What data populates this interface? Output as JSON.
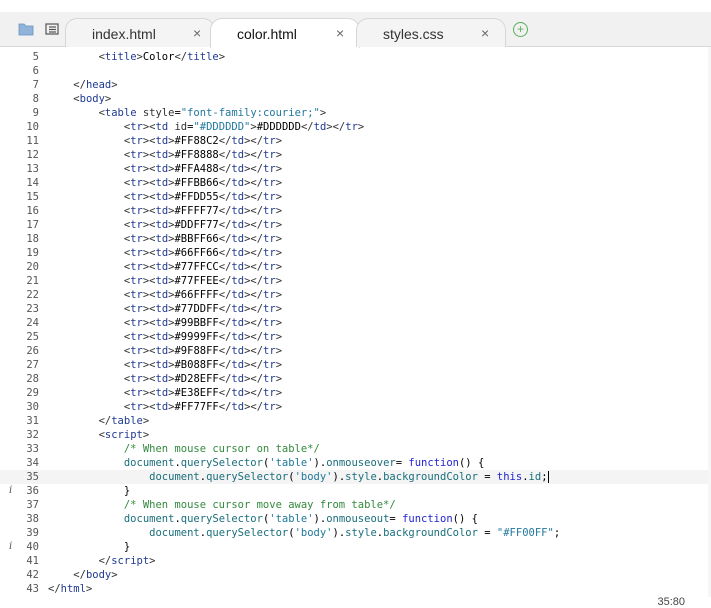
{
  "toolbar": {
    "icons": [
      "folder-icon",
      "outline-icon"
    ]
  },
  "tabs": [
    {
      "label": "index.html",
      "close": "×",
      "active": false
    },
    {
      "label": "color.html",
      "close": "×",
      "active": true
    },
    {
      "label": "styles.css",
      "close": "×",
      "active": false
    }
  ],
  "add_tab": "+",
  "colors": {
    "tag": "#1f3a93",
    "string": "#21789e",
    "keyword": "#2323d4",
    "comment": "#338a3e",
    "add_button": "#57b05a"
  },
  "editor": {
    "lines": [
      {
        "n": "5",
        "html": "        <span class=\"b\">&lt;</span><span class=\"t\">title</span><span class=\"b\">&gt;</span>Color<span class=\"b\">&lt;/</span><span class=\"t\">title</span><span class=\"b\">&gt;</span>"
      },
      {
        "n": "6",
        "html": ""
      },
      {
        "n": "7",
        "html": "    <span class=\"b\">&lt;/</span><span class=\"t\">head</span><span class=\"b\">&gt;</span>"
      },
      {
        "n": "8",
        "html": "    <span class=\"b\">&lt;</span><span class=\"t\">body</span><span class=\"b\">&gt;</span>"
      },
      {
        "n": "9",
        "html": "        <span class=\"b\">&lt;</span><span class=\"t\">table</span> <span class=\"a\">style</span>=<span class=\"s\">\"font-family:courier;\"</span><span class=\"b\">&gt;</span>"
      },
      {
        "n": "10",
        "html": "            <span class=\"b\">&lt;</span><span class=\"t\">tr</span><span class=\"b\">&gt;&lt;</span><span class=\"t\">td</span> <span class=\"a\">id</span>=<span class=\"s\">\"#DDDDDD\"</span><span class=\"b\">&gt;</span>#DDDDDD<span class=\"b\">&lt;/</span><span class=\"t\">td</span><span class=\"b\">&gt;&lt;/</span><span class=\"t\">tr</span><span class=\"b\">&gt;</span>"
      },
      {
        "n": "11",
        "td": "#FF88C2"
      },
      {
        "n": "12",
        "td": "#FF8888"
      },
      {
        "n": "13",
        "td": "#FFA488"
      },
      {
        "n": "14",
        "td": "#FFBB66"
      },
      {
        "n": "15",
        "td": "#FFDD55"
      },
      {
        "n": "16",
        "td": "#FFFF77"
      },
      {
        "n": "17",
        "td": "#DDFF77"
      },
      {
        "n": "18",
        "td": "#BBFF66"
      },
      {
        "n": "19",
        "td": "#66FF66"
      },
      {
        "n": "20",
        "td": "#77FFCC"
      },
      {
        "n": "21",
        "td": "#77FFEE"
      },
      {
        "n": "22",
        "td": "#66FFFF"
      },
      {
        "n": "23",
        "td": "#77DDFF"
      },
      {
        "n": "24",
        "td": "#99BBFF"
      },
      {
        "n": "25",
        "td": "#9999FF"
      },
      {
        "n": "26",
        "td": "#9F88FF"
      },
      {
        "n": "27",
        "td": "#B088FF"
      },
      {
        "n": "28",
        "td": "#D28EFF"
      },
      {
        "n": "29",
        "td": "#E38EFF"
      },
      {
        "n": "30",
        "td": "#FF77FF"
      },
      {
        "n": "31",
        "html": "        <span class=\"b\">&lt;/</span><span class=\"t\">table</span><span class=\"b\">&gt;</span>"
      },
      {
        "n": "32",
        "html": "        <span class=\"b\">&lt;</span><span class=\"t\">script</span><span class=\"b\">&gt;</span>"
      },
      {
        "n": "33",
        "html": "            <span class=\"c\">/* When mouse cursor on table*/</span>"
      },
      {
        "n": "34",
        "html": "            <span class=\"p\">document</span>.<span class=\"p\">querySelector</span>(<span class=\"s\">'table'</span>).<span class=\"p\">onmouseover</span>= <span class=\"k\">function</span>() {"
      },
      {
        "n": "35",
        "current": true,
        "html": "                <span class=\"p\">document</span>.<span class=\"p\">querySelector</span>(<span class=\"s\">'body'</span>).<span class=\"p\">style</span>.<span class=\"p\">backgroundColor</span> = <span class=\"k\">this</span>.<span class=\"p\">id</span>;<span class=\"cursor\"></span>"
      },
      {
        "n": "36",
        "info": "i",
        "html": "            }"
      },
      {
        "n": "37",
        "html": "            <span class=\"c\">/* When mouse cursor move away from table*/</span>"
      },
      {
        "n": "38",
        "html": "            <span class=\"p\">document</span>.<span class=\"p\">querySelector</span>(<span class=\"s\">'table'</span>).<span class=\"p\">onmouseout</span>= <span class=\"k\">function</span>() {"
      },
      {
        "n": "39",
        "html": "                <span class=\"p\">document</span>.<span class=\"p\">querySelector</span>(<span class=\"s\">'body'</span>).<span class=\"p\">style</span>.<span class=\"p\">backgroundColor</span> = <span class=\"s\">\"#FF00FF\"</span>;"
      },
      {
        "n": "40",
        "info": "i",
        "html": "            }"
      },
      {
        "n": "41",
        "html": "        <span class=\"b\">&lt;/</span><span class=\"t\">script</span><span class=\"b\">&gt;</span>"
      },
      {
        "n": "42",
        "html": "    <span class=\"b\">&lt;/</span><span class=\"t\">body</span><span class=\"b\">&gt;</span>"
      },
      {
        "n": "43",
        "html": "<span class=\"b\">&lt;/</span><span class=\"t\">html</span><span class=\"b\">&gt;</span>"
      }
    ]
  },
  "status": {
    "cursor_position": "35:80"
  }
}
